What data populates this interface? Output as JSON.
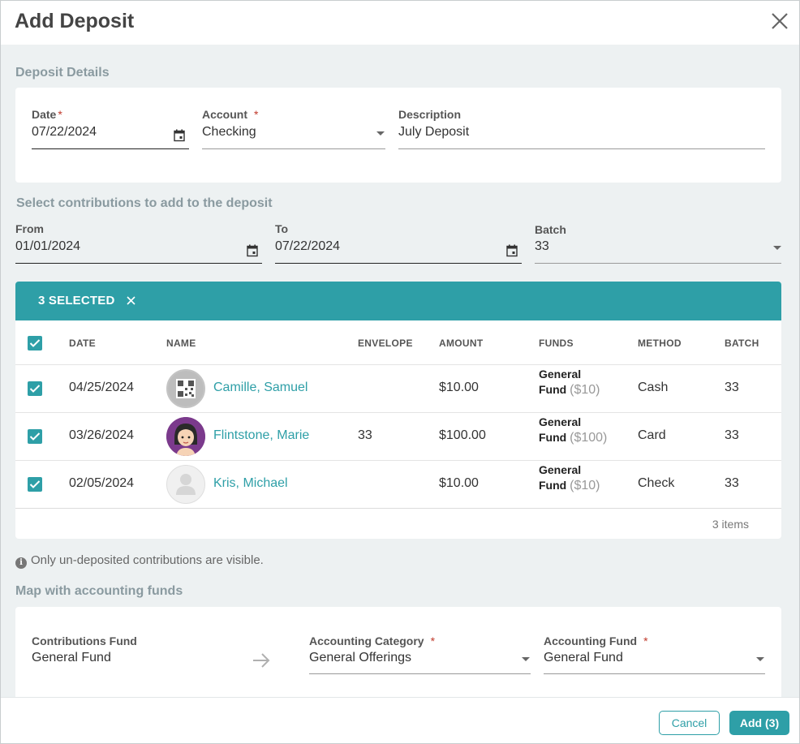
{
  "dialog": {
    "title": "Add Deposit"
  },
  "deposit_details": {
    "section_label": "Deposit Details",
    "date": {
      "label": "Date",
      "required_mark": "*",
      "value": "07/22/2024"
    },
    "account": {
      "label": "Account",
      "required_mark": "*",
      "value": "Checking"
    },
    "description": {
      "label": "Description",
      "value": "July Deposit"
    }
  },
  "contributions": {
    "section_label": "Select contributions to add to the deposit",
    "from": {
      "label": "From",
      "value": "01/01/2024"
    },
    "to": {
      "label": "To",
      "value": "07/22/2024"
    },
    "batch": {
      "label": "Batch",
      "value": "33"
    }
  },
  "selection": {
    "count_label": "3 SELECTED"
  },
  "table": {
    "columns": [
      "DATE",
      "NAME",
      "ENVELOPE",
      "AMOUNT",
      "FUNDS",
      "METHOD",
      "BATCH"
    ],
    "rows": [
      {
        "date": "04/25/2024",
        "name": "Camille, Samuel",
        "envelope": "",
        "amount": "$10.00",
        "fund_line1": "General",
        "fund_line2": "Fund",
        "fund_amount": "($10)",
        "method": "Cash",
        "batch": "33",
        "avatar": "qr-code-avatar"
      },
      {
        "date": "03/26/2024",
        "name": "Flintstone, Marie",
        "envelope": "33",
        "amount": "$100.00",
        "fund_line1": "General",
        "fund_line2": "Fund",
        "fund_amount": "($100)",
        "method": "Card",
        "batch": "33",
        "avatar": "cartoon-girl-avatar"
      },
      {
        "date": "02/05/2024",
        "name": "Kris, Michael",
        "envelope": "",
        "amount": "$10.00",
        "fund_line1": "General",
        "fund_line2": "Fund",
        "fund_amount": "($10)",
        "method": "Check",
        "batch": "33",
        "avatar": "placeholder-person-avatar"
      }
    ],
    "items_count": "3 items"
  },
  "note": "Only un-deposited contributions are visible.",
  "mapping": {
    "section_label": "Map with accounting funds",
    "contributions_fund": {
      "label": "Contributions Fund",
      "value": "General Fund"
    },
    "accounting_category": {
      "label": "Accounting Category",
      "required_mark": "*",
      "value": "General Offerings"
    },
    "accounting_fund": {
      "label": "Accounting Fund",
      "required_mark": "*",
      "value": "General Fund"
    }
  },
  "buttons": {
    "cancel": "Cancel",
    "add": "Add (3)"
  },
  "colors": {
    "accent": "#2e9fa7",
    "background": "#edf1f2",
    "required": "#c0392b"
  }
}
